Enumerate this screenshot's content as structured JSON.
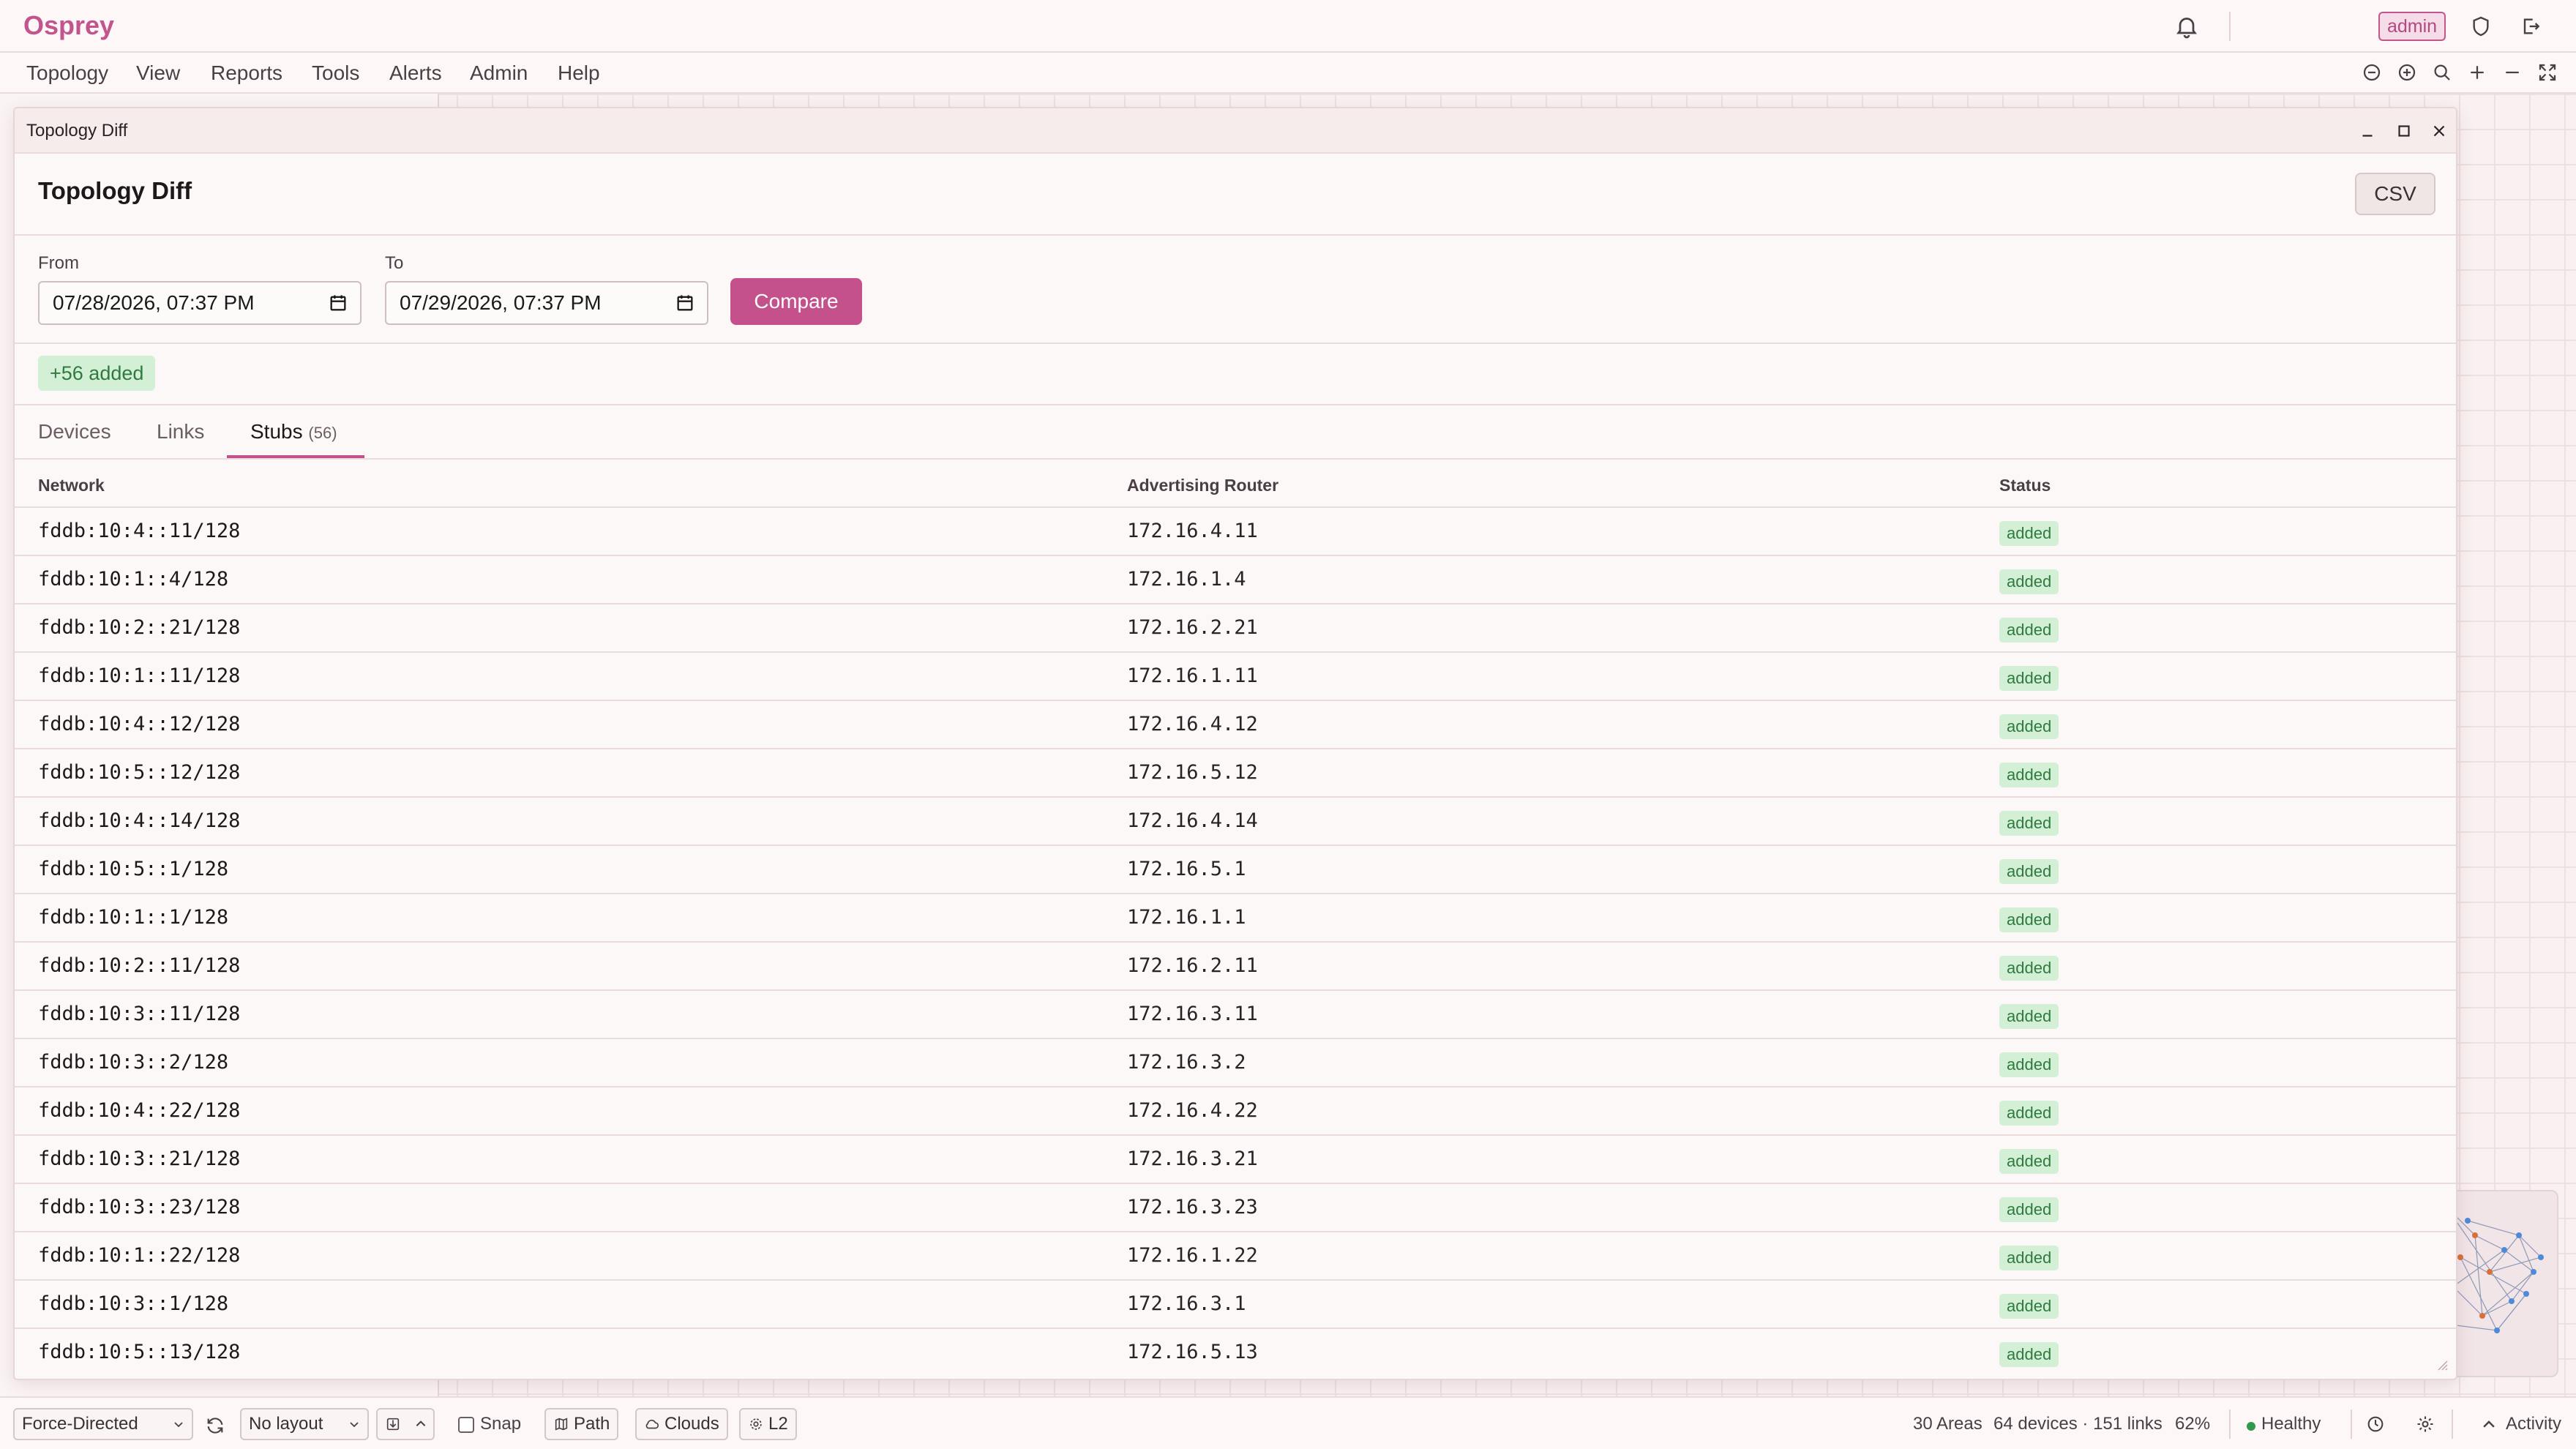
{
  "app": {
    "brand": "Osprey",
    "user_badge": "admin",
    "menu": [
      "Topology",
      "View",
      "Reports",
      "Tools",
      "Alerts",
      "Admin",
      "Help"
    ]
  },
  "dialog": {
    "window_title": "Topology Diff",
    "heading": "Topology Diff",
    "csv_label": "CSV",
    "from_label": "From",
    "from_value": "07/28/2026, 07:37 PM",
    "to_label": "To",
    "to_value": "07/29/2026, 07:37 PM",
    "compare_label": "Compare",
    "summary_badge": "+56 added",
    "tabs": {
      "devices": "Devices",
      "links": "Links",
      "stubs": "Stubs",
      "stubs_count": "(56)"
    },
    "columns": {
      "network": "Network",
      "router": "Advertising Router",
      "status": "Status"
    },
    "rows": [
      {
        "network": "fddb:10:4::11/128",
        "router": "172.16.4.11",
        "status": "added"
      },
      {
        "network": "fddb:10:1::4/128",
        "router": "172.16.1.4",
        "status": "added"
      },
      {
        "network": "fddb:10:2::21/128",
        "router": "172.16.2.21",
        "status": "added"
      },
      {
        "network": "fddb:10:1::11/128",
        "router": "172.16.1.11",
        "status": "added"
      },
      {
        "network": "fddb:10:4::12/128",
        "router": "172.16.4.12",
        "status": "added"
      },
      {
        "network": "fddb:10:5::12/128",
        "router": "172.16.5.12",
        "status": "added"
      },
      {
        "network": "fddb:10:4::14/128",
        "router": "172.16.4.14",
        "status": "added"
      },
      {
        "network": "fddb:10:5::1/128",
        "router": "172.16.5.1",
        "status": "added"
      },
      {
        "network": "fddb:10:1::1/128",
        "router": "172.16.1.1",
        "status": "added"
      },
      {
        "network": "fddb:10:2::11/128",
        "router": "172.16.2.11",
        "status": "added"
      },
      {
        "network": "fddb:10:3::11/128",
        "router": "172.16.3.11",
        "status": "added"
      },
      {
        "network": "fddb:10:3::2/128",
        "router": "172.16.3.2",
        "status": "added"
      },
      {
        "network": "fddb:10:4::22/128",
        "router": "172.16.4.22",
        "status": "added"
      },
      {
        "network": "fddb:10:3::21/128",
        "router": "172.16.3.21",
        "status": "added"
      },
      {
        "network": "fddb:10:3::23/128",
        "router": "172.16.3.23",
        "status": "added"
      },
      {
        "network": "fddb:10:1::22/128",
        "router": "172.16.1.22",
        "status": "added"
      },
      {
        "network": "fddb:10:3::1/128",
        "router": "172.16.3.1",
        "status": "added"
      },
      {
        "network": "fddb:10:5::13/128",
        "router": "172.16.5.13",
        "status": "added"
      }
    ]
  },
  "statusbar": {
    "algorithm": "Force-Directed",
    "layout": "No layout",
    "snap_label": "Snap",
    "path_label": "Path",
    "clouds_label": "Clouds",
    "l2_label": "L2",
    "areas": "30 Areas",
    "devices_links": "64 devices · 151 links",
    "zoom": "62%",
    "health": "Healthy",
    "activity": "Activity"
  },
  "colors": {
    "accent": "#c4518c",
    "brand": "#c2558d",
    "added_bg": "#d3f0d7",
    "added_fg": "#2f7a3e",
    "healthy": "#2f9a4c"
  },
  "icons": [
    "bell-icon",
    "shield-icon",
    "logout-icon",
    "zoom-out-icon",
    "zoom-in-icon",
    "search-icon",
    "plus-icon",
    "minus-icon",
    "fullscreen-icon",
    "minimize-icon",
    "maximize-icon",
    "close-icon",
    "calendar-icon",
    "refresh-icon",
    "save-icon",
    "chevron-up-icon",
    "path-icon",
    "cloud-icon",
    "gear-icon",
    "clock-icon",
    "chevron-down-icon"
  ]
}
